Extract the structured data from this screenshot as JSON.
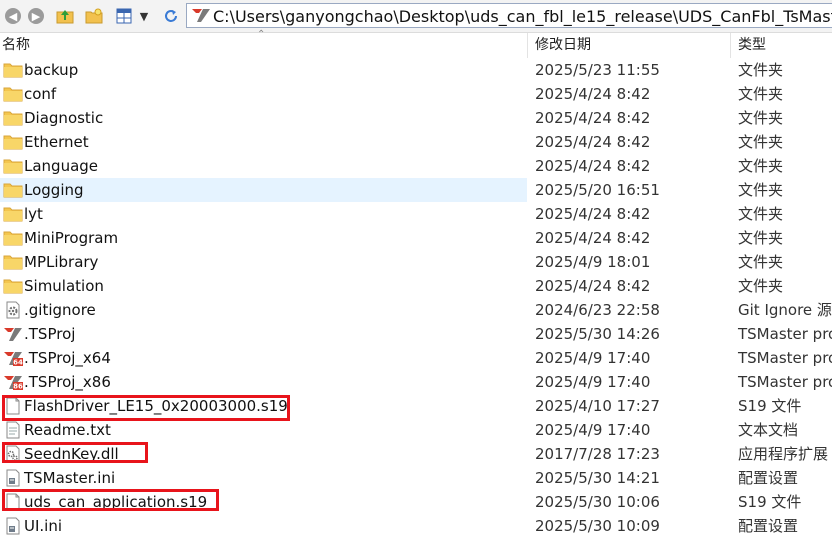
{
  "address": {
    "path": "C:\\Users\\ganyongchao\\Desktop\\uds_can_fbl_le15_release\\UDS_CanFbl_TsMaster\\"
  },
  "columns": {
    "name": "名称",
    "date": "修改日期",
    "type": "类型"
  },
  "rows": [
    {
      "name": "backup",
      "date": "2025/5/23 11:55",
      "type": "文件夹",
      "icon": "folder-icon"
    },
    {
      "name": "conf",
      "date": "2025/4/24 8:42",
      "type": "文件夹",
      "icon": "folder-icon"
    },
    {
      "name": "Diagnostic",
      "date": "2025/4/24 8:42",
      "type": "文件夹",
      "icon": "folder-icon"
    },
    {
      "name": "Ethernet",
      "date": "2025/4/24 8:42",
      "type": "文件夹",
      "icon": "folder-icon"
    },
    {
      "name": "Language",
      "date": "2025/4/24 8:42",
      "type": "文件夹",
      "icon": "folder-icon"
    },
    {
      "name": "Logging",
      "date": "2025/5/20 16:51",
      "type": "文件夹",
      "icon": "folder-icon"
    },
    {
      "name": "lyt",
      "date": "2025/4/24 8:42",
      "type": "文件夹",
      "icon": "folder-icon"
    },
    {
      "name": "MiniProgram",
      "date": "2025/4/24 8:42",
      "type": "文件夹",
      "icon": "folder-icon"
    },
    {
      "name": "MPLibrary",
      "date": "2025/4/9 18:01",
      "type": "文件夹",
      "icon": "folder-icon"
    },
    {
      "name": "Simulation",
      "date": "2025/4/24 8:42",
      "type": "文件夹",
      "icon": "folder-icon"
    },
    {
      "name": ".gitignore",
      "date": "2024/6/23 22:58",
      "type": "Git Ignore 源文件",
      "icon": "gear-file-icon"
    },
    {
      "name": ".TSProj",
      "date": "2025/5/30 14:26",
      "type": "TSMaster project",
      "icon": "tsmaster-logo-icon"
    },
    {
      "name": ".TSProj_x64",
      "date": "2025/4/9 17:40",
      "type": "TSMaster project",
      "icon": "tsmaster-x64-icon",
      "badge": "64"
    },
    {
      "name": ".TSProj_x86",
      "date": "2025/4/9 17:40",
      "type": "TSMaster project",
      "icon": "tsmaster-x86-icon",
      "badge": "86"
    },
    {
      "name": "FlashDriver_LE15_0x20003000.s19",
      "date": "2025/4/10 17:27",
      "type": "S19 文件",
      "icon": "file-icon"
    },
    {
      "name": "Readme.txt",
      "date": "2025/4/9 17:40",
      "type": "文本文档",
      "icon": "text-file-icon"
    },
    {
      "name": "SeednKey.dll",
      "date": "2017/7/28 17:23",
      "type": "应用程序扩展",
      "icon": "dll-file-icon"
    },
    {
      "name": "TSMaster.ini",
      "date": "2025/5/30 14:21",
      "type": "配置设置",
      "icon": "ini-file-icon"
    },
    {
      "name": "uds_can_application.s19",
      "date": "2025/5/30 10:06",
      "type": "S19 文件",
      "icon": "file-icon"
    },
    {
      "name": "UI.ini",
      "date": "2025/5/30 10:09",
      "type": "配置设置",
      "icon": "ini-file-icon"
    }
  ]
}
